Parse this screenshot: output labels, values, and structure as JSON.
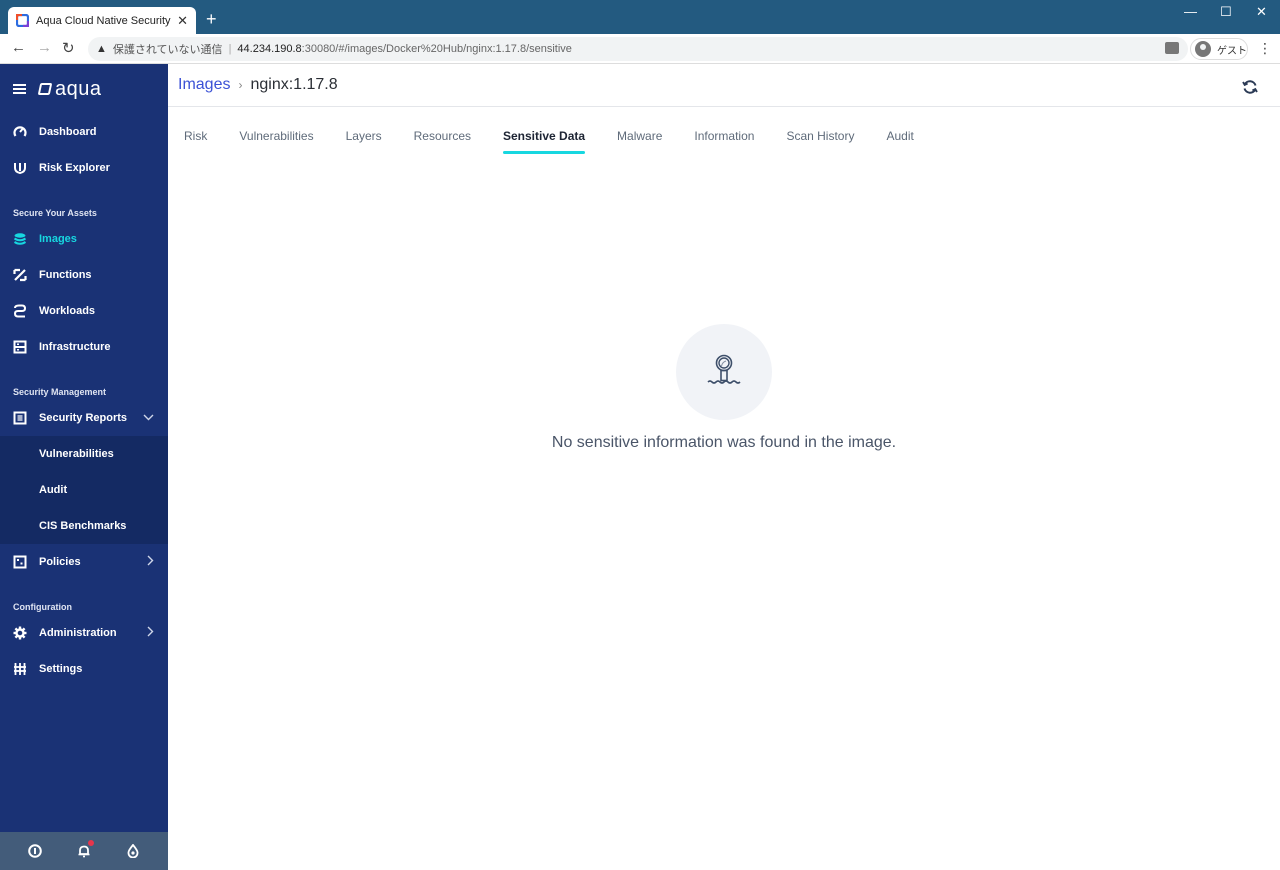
{
  "browser": {
    "tab_title": "Aqua Cloud Native Security Platfo",
    "new_tab": "+",
    "tab_close": "✕",
    "window_controls": {
      "minimize": "—",
      "maximize": "☐",
      "close": "✕"
    },
    "nav": {
      "back": "←",
      "forward": "→",
      "reload": "↻"
    },
    "address": {
      "warning_icon": "▲",
      "insecure_label": "保護されていない通信",
      "separator": "|",
      "host": "44.234.190.8",
      "path": ":30080/#/images/Docker%20Hub/nginx:1.17.8/sensitive"
    },
    "profile_label": "ゲスト",
    "menu": "⋮"
  },
  "sidebar": {
    "logo_text": "aqua",
    "top_items": [
      {
        "label": "Dashboard",
        "icon": "gauge-icon"
      },
      {
        "label": "Risk Explorer",
        "icon": "risk-explorer-icon"
      }
    ],
    "sections": [
      {
        "title": "Secure Your Assets",
        "items": [
          {
            "label": "Images",
            "icon": "layers-icon",
            "active": true
          },
          {
            "label": "Functions",
            "icon": "functions-icon"
          },
          {
            "label": "Workloads",
            "icon": "workloads-icon"
          },
          {
            "label": "Infrastructure",
            "icon": "infrastructure-icon"
          }
        ]
      },
      {
        "title": "Security Management",
        "items": [
          {
            "label": "Security Reports",
            "icon": "report-icon",
            "expanded": true,
            "chevron": "⌄"
          },
          {
            "label": "Vulnerabilities",
            "sub": true
          },
          {
            "label": "Audit",
            "sub": true
          },
          {
            "label": "CIS Benchmarks",
            "sub": true
          },
          {
            "label": "Policies",
            "icon": "policies-icon",
            "chevron": "›"
          }
        ]
      },
      {
        "title": "Configuration",
        "items": [
          {
            "label": "Administration",
            "icon": "gear-icon",
            "chevron": "›"
          },
          {
            "label": "Settings",
            "icon": "sliders-icon"
          }
        ]
      }
    ],
    "footer": {
      "info": "ⓘ",
      "notifications": "🔔",
      "drop": "◬"
    }
  },
  "main": {
    "breadcrumb": {
      "parent": "Images",
      "separator": "›",
      "current": "nginx:1.17.8"
    },
    "tabs": [
      {
        "label": "Risk"
      },
      {
        "label": "Vulnerabilities"
      },
      {
        "label": "Layers"
      },
      {
        "label": "Resources"
      },
      {
        "label": "Sensitive Data",
        "active": true
      },
      {
        "label": "Malware"
      },
      {
        "label": "Information"
      },
      {
        "label": "Scan History"
      },
      {
        "label": "Audit"
      }
    ],
    "empty_state": {
      "icon": "periscope-icon",
      "message": "No sensitive information was found in the image."
    }
  },
  "colors": {
    "sidebar_bg": "#1a3275",
    "accent": "#17d7e0",
    "link": "#3c52d6",
    "titlebar": "#235a80",
    "notification_dot": "#e8354b"
  }
}
